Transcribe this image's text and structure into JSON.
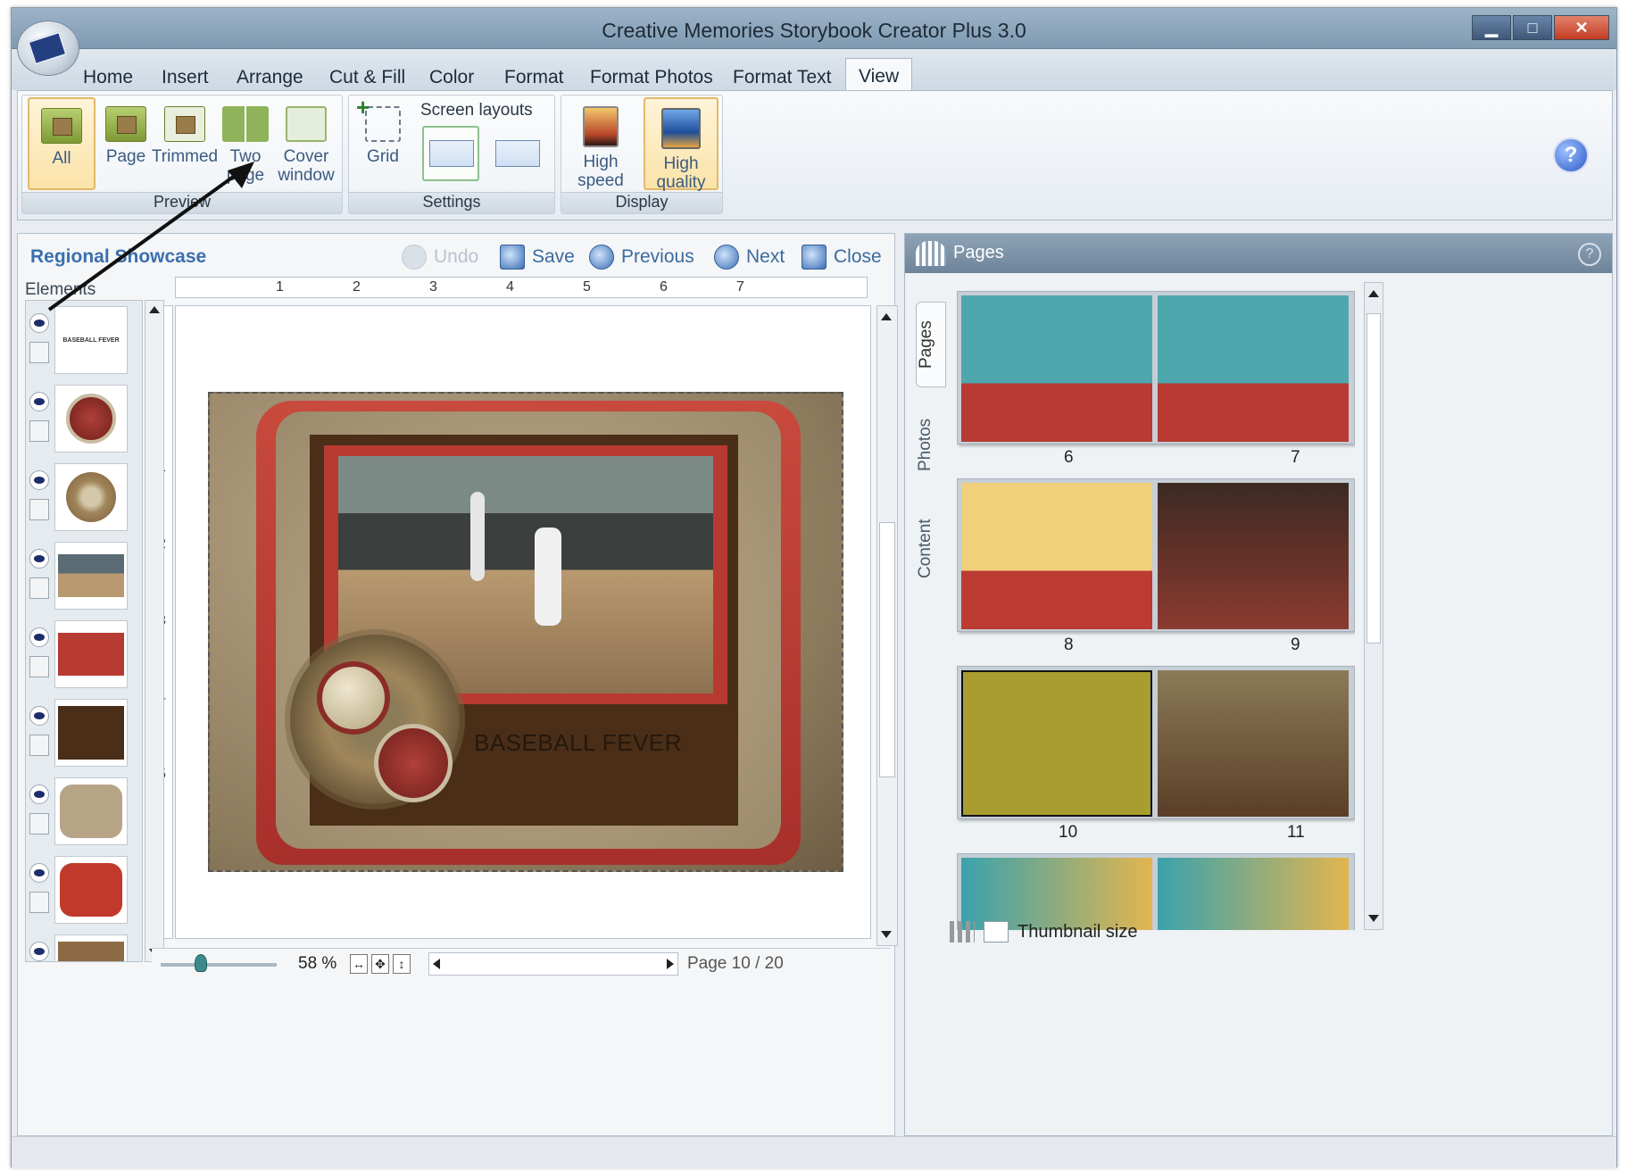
{
  "app": {
    "title": "Creative Memories Storybook Creator Plus 3.0"
  },
  "window_buttons": {
    "minimize": "▁",
    "maximize": "□",
    "close": "✕"
  },
  "menu": [
    "Home",
    "Insert",
    "Arrange",
    "Cut & Fill",
    "Color",
    "Format",
    "Format Photos",
    "Format Text",
    "View"
  ],
  "ribbon": {
    "preview": {
      "label": "Preview",
      "buttons": [
        "All",
        "Page",
        "Trimmed",
        "Two\npage",
        "Cover\nwindow"
      ]
    },
    "settings": {
      "label": "Settings",
      "grid": "Grid",
      "screen_layouts": "Screen layouts"
    },
    "display": {
      "label": "Display",
      "high_speed": "High\nspeed",
      "high_quality": "High\nquality"
    },
    "help": "?"
  },
  "editor": {
    "project": "Regional Showcase",
    "toolbar": {
      "undo": "Undo",
      "save": "Save",
      "previous": "Previous",
      "next": "Next",
      "close": "Close"
    },
    "elements_label": "Elements",
    "element_thumb_text": "BASEBALL FEVER",
    "ruler_h": [
      "1",
      "2",
      "3",
      "4",
      "5",
      "6",
      "7"
    ],
    "ruler_v": [
      "1",
      "2",
      "3",
      "4",
      "5"
    ],
    "page_title": "BASEBALL FEVER",
    "zoom": "58 %",
    "page_indicator": "Page 10 / 20"
  },
  "pages_panel": {
    "title": "Pages",
    "help": "?",
    "tabs": [
      "Pages",
      "Photos",
      "Content"
    ],
    "spreads": [
      [
        "6",
        "7"
      ],
      [
        "8",
        "9"
      ],
      [
        "10",
        "11"
      ],
      [
        "",
        ""
      ]
    ],
    "thumbnail_size": "Thumbnail size"
  }
}
